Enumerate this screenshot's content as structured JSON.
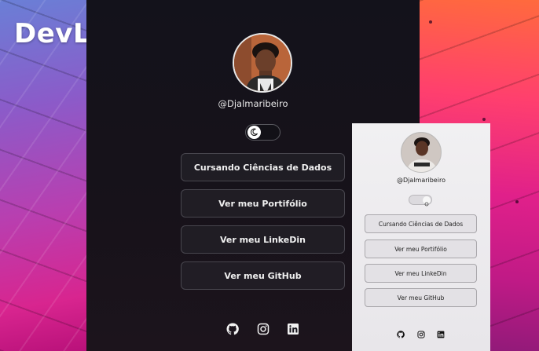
{
  "brand": {
    "title": "DevLinks"
  },
  "dark_preview": {
    "username": "@Djalmaribeiro",
    "toggle_state": "dark",
    "links": [
      {
        "label": "Cursando Ciências de Dados"
      },
      {
        "label": "Ver meu Portifólio"
      },
      {
        "label": "Ver meu LinkeDin"
      },
      {
        "label": "Ver meu GitHub"
      }
    ],
    "social_icons": [
      "github-icon",
      "instagram-icon",
      "linkedin-icon"
    ]
  },
  "light_preview": {
    "username": "@Djalmaribeiro",
    "toggle_state": "light",
    "links": [
      {
        "label": "Cursando Ciências de Dados"
      },
      {
        "label": "Ver meu Portifólio"
      },
      {
        "label": "Ver meu LinkeDin"
      },
      {
        "label": "Ver meu GitHub"
      }
    ],
    "social_icons": [
      "github-icon",
      "instagram-icon",
      "linkedin-icon"
    ]
  },
  "colors": {
    "dark_bg": "#13121b",
    "light_bg": "#f1f0f2",
    "accent_pink": "#e0208a",
    "accent_orange": "#ff6a3d"
  }
}
